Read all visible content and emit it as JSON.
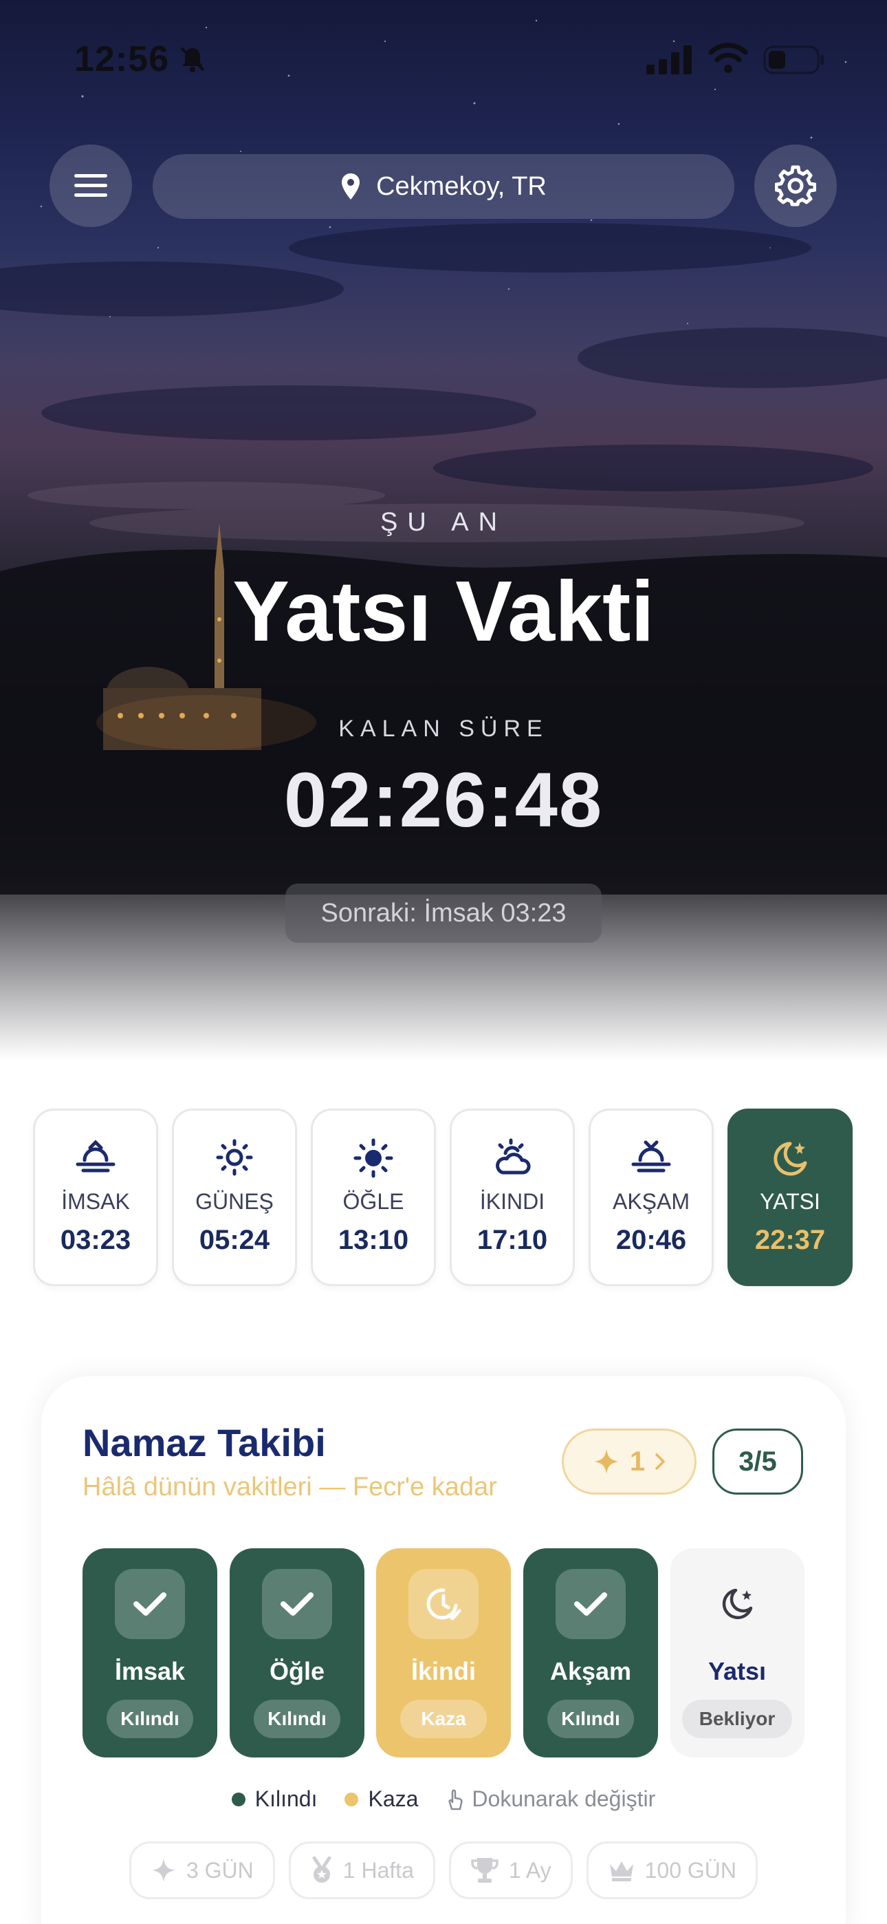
{
  "status_bar": {
    "time": "12:56"
  },
  "header": {
    "location": "Cekmekoy, TR"
  },
  "hero": {
    "now_label": "ŞU AN",
    "current_prayer": "Yatsı Vakti",
    "remaining_label": "KALAN SÜRE",
    "countdown": "02:26:48",
    "next": "Sonraki: İmsak 03:23"
  },
  "times": [
    {
      "name": "İMSAK",
      "time": "03:23",
      "icon": "sunrise-icon"
    },
    {
      "name": "GÜNEŞ",
      "time": "05:24",
      "icon": "sun-outline-icon"
    },
    {
      "name": "ÖĞLE",
      "time": "13:10",
      "icon": "sun-icon"
    },
    {
      "name": "İKINDI",
      "time": "17:10",
      "icon": "cloud-sun-icon"
    },
    {
      "name": "AKŞAM",
      "time": "20:46",
      "icon": "sunset-icon"
    },
    {
      "name": "YATSI",
      "time": "22:37",
      "icon": "moon-star-icon",
      "active": true
    }
  ],
  "tracker": {
    "title": "Namaz Takibi",
    "subtitle": "Hâlâ dünün vakitleri — Fecr'e kadar",
    "streak": "1",
    "count": "3/5",
    "prayers": [
      {
        "name": "İmsak",
        "status": "Kılındı",
        "state": "done"
      },
      {
        "name": "Öğle",
        "status": "Kılındı",
        "state": "done"
      },
      {
        "name": "İkindi",
        "status": "Kaza",
        "state": "kaza"
      },
      {
        "name": "Akşam",
        "status": "Kılındı",
        "state": "done"
      },
      {
        "name": "Yatsı",
        "status": "Bekliyor",
        "state": "waiting"
      }
    ],
    "legend": {
      "done": "Kılındı",
      "kaza": "Kaza",
      "hint": "Dokunarak değiştir"
    },
    "badges": [
      {
        "label": "3 GÜN",
        "icon": "sparkle-icon"
      },
      {
        "label": "1 Hafta",
        "icon": "medal-icon"
      },
      {
        "label": "1 Ay",
        "icon": "trophy-icon"
      },
      {
        "label": "100 GÜN",
        "icon": "crown-icon"
      }
    ]
  },
  "colors": {
    "accent_green": "#2f5b4c",
    "gold": "#e8c06c",
    "navy": "#1a2a6e",
    "kaza_yellow": "#ecc46c"
  }
}
